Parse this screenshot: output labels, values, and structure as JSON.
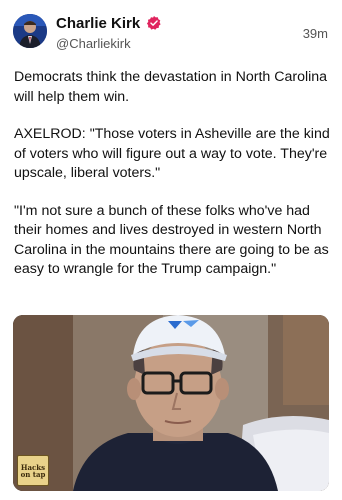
{
  "post": {
    "author": {
      "display_name": "Charlie Kirk",
      "handle": "@Charliekirk",
      "verified": true,
      "avatar_icon": "avatar-photo"
    },
    "timestamp": "39m",
    "paragraphs": [
      "Democrats think the devastation in North Carolina will help them win.",
      "AXELROD: \"Those voters in Asheville are the kind of voters who will figure out a way to vote. They're upscale, liberal voters.\"",
      "\"I'm not sure a bunch of these folks who've had their homes and lives destroyed in western North Carolina in the mountains there are going to be as easy to wrangle for the Trump campaign.\""
    ],
    "media": {
      "type": "video-still",
      "watermark": {
        "top": "",
        "line1": "Hacks",
        "line2": "on tap"
      }
    }
  },
  "colors": {
    "verified_badge": "#e0245e",
    "text": "#111111",
    "muted": "#555555"
  }
}
